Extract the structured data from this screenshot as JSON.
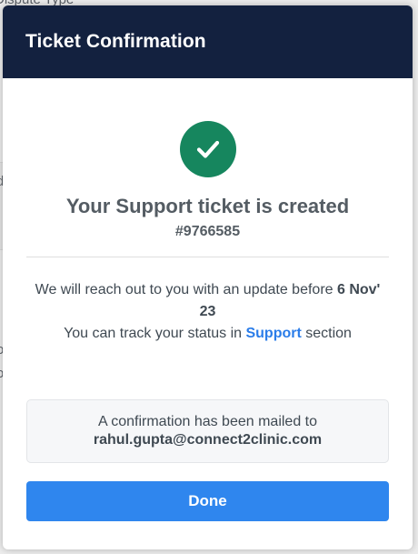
{
  "background": {
    "label_top": "Dispute Type",
    "fragment_1": "d",
    "fragment_2": "o",
    "fragment_3": "o"
  },
  "modal": {
    "title": "Ticket Confirmation",
    "success_icon": "check-circle-icon",
    "headline": "Your Support ticket is created",
    "ticket_number": "#9766585",
    "message": {
      "line1_prefix": "We will reach out to you with an update before ",
      "date_bold": "6 Nov' 23",
      "line2_prefix": "You can track your status in ",
      "support_link": "Support",
      "line2_suffix": " section"
    },
    "mail_box": {
      "text": "A confirmation has been mailed to",
      "email": "rahul.gupta@connect2clinic.com"
    },
    "done_label": "Done"
  },
  "colors": {
    "header_bg": "#13213f",
    "success_green": "#16865e",
    "link_blue": "#2b7de9",
    "button_blue": "#2f86ee",
    "text_gray": "#545c63"
  }
}
